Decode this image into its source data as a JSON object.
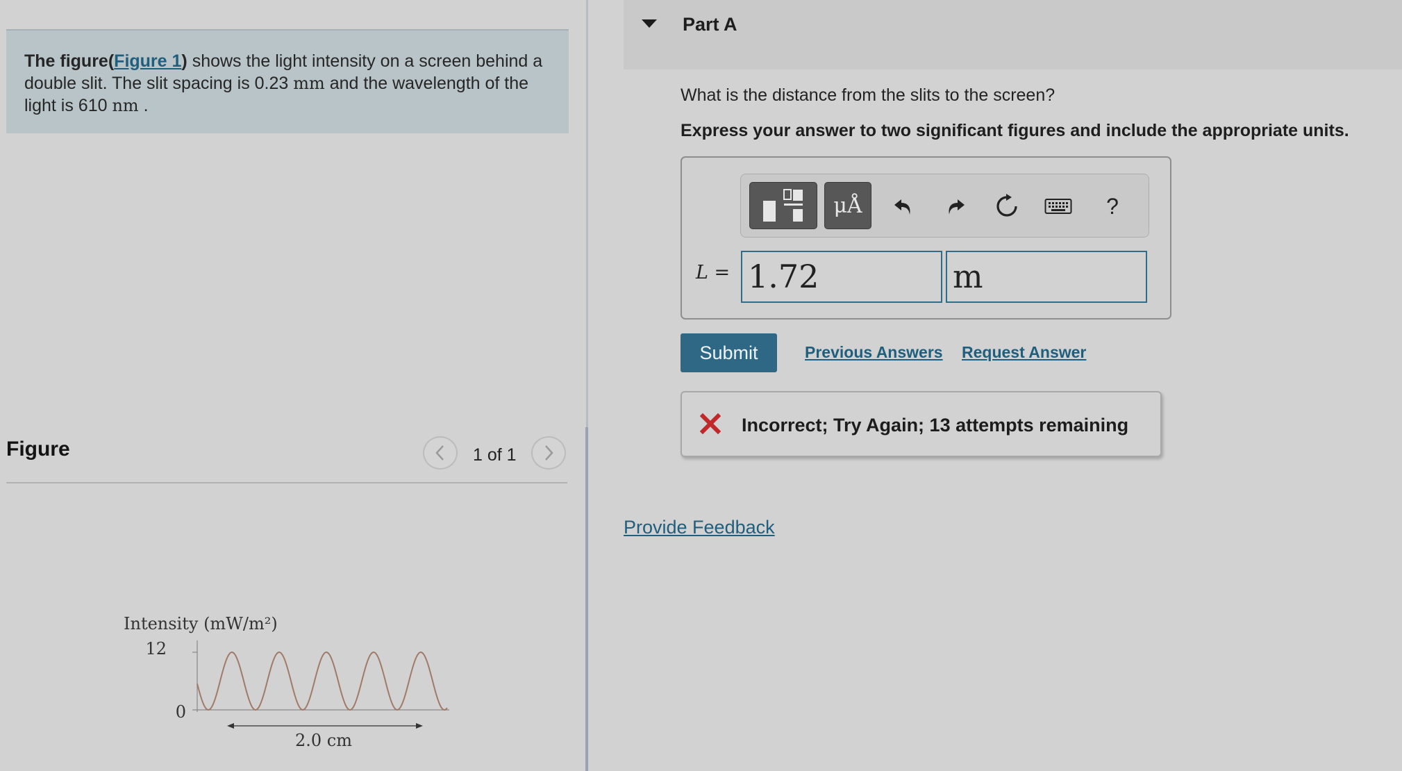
{
  "problem": {
    "intro_bold": "The figure(",
    "figure_link": "Figure 1",
    "close_paren": ")",
    "text_1": " shows the light intensity on a screen behind a double slit. The slit spacing is 0.23 ",
    "unit_mm": "mm",
    "text_2": " and the wavelength of the light is 610 ",
    "unit_nm": "nm",
    "text_3": " ."
  },
  "figure_panel": {
    "title": "Figure",
    "counter": "1 of 1",
    "prev_icon": "chevron-left-icon",
    "next_icon": "chevron-right-icon",
    "graph": {
      "y_axis_label": "Intensity (mW/m²)",
      "y_tick_top": "12",
      "y_tick_zero": "0",
      "span_label": "2.0 cm",
      "curve_color": "#a07a68"
    }
  },
  "part": {
    "title": "Part A",
    "caret_icon": "caret-down-icon",
    "question": "What is the distance from the slits to the screen?",
    "instruction": "Express your answer to two significant figures and include the appropriate units."
  },
  "toolbar": {
    "templates_icon": "templates-icon",
    "units_label": "μÅ",
    "undo_icon": "undo-icon",
    "redo_icon": "redo-icon",
    "reset_icon": "reset-icon",
    "keyboard_icon": "keyboard-icon",
    "help_label": "?"
  },
  "answer": {
    "variable": "L",
    "equals": " =",
    "value": "1.72",
    "unit": "m"
  },
  "actions": {
    "submit_label": "Submit",
    "previous_answers_label": "Previous Answers",
    "request_answer_label": "Request Answer"
  },
  "feedback": {
    "icon": "x-icon",
    "message": "Incorrect; Try Again; 13 attempts remaining"
  },
  "footer": {
    "provide_feedback_label": "Provide Feedback"
  },
  "colors": {
    "accent": "#2e6884",
    "link": "#1f5e7c",
    "error": "#c0282a",
    "problem_bg": "#b8c4c8"
  }
}
